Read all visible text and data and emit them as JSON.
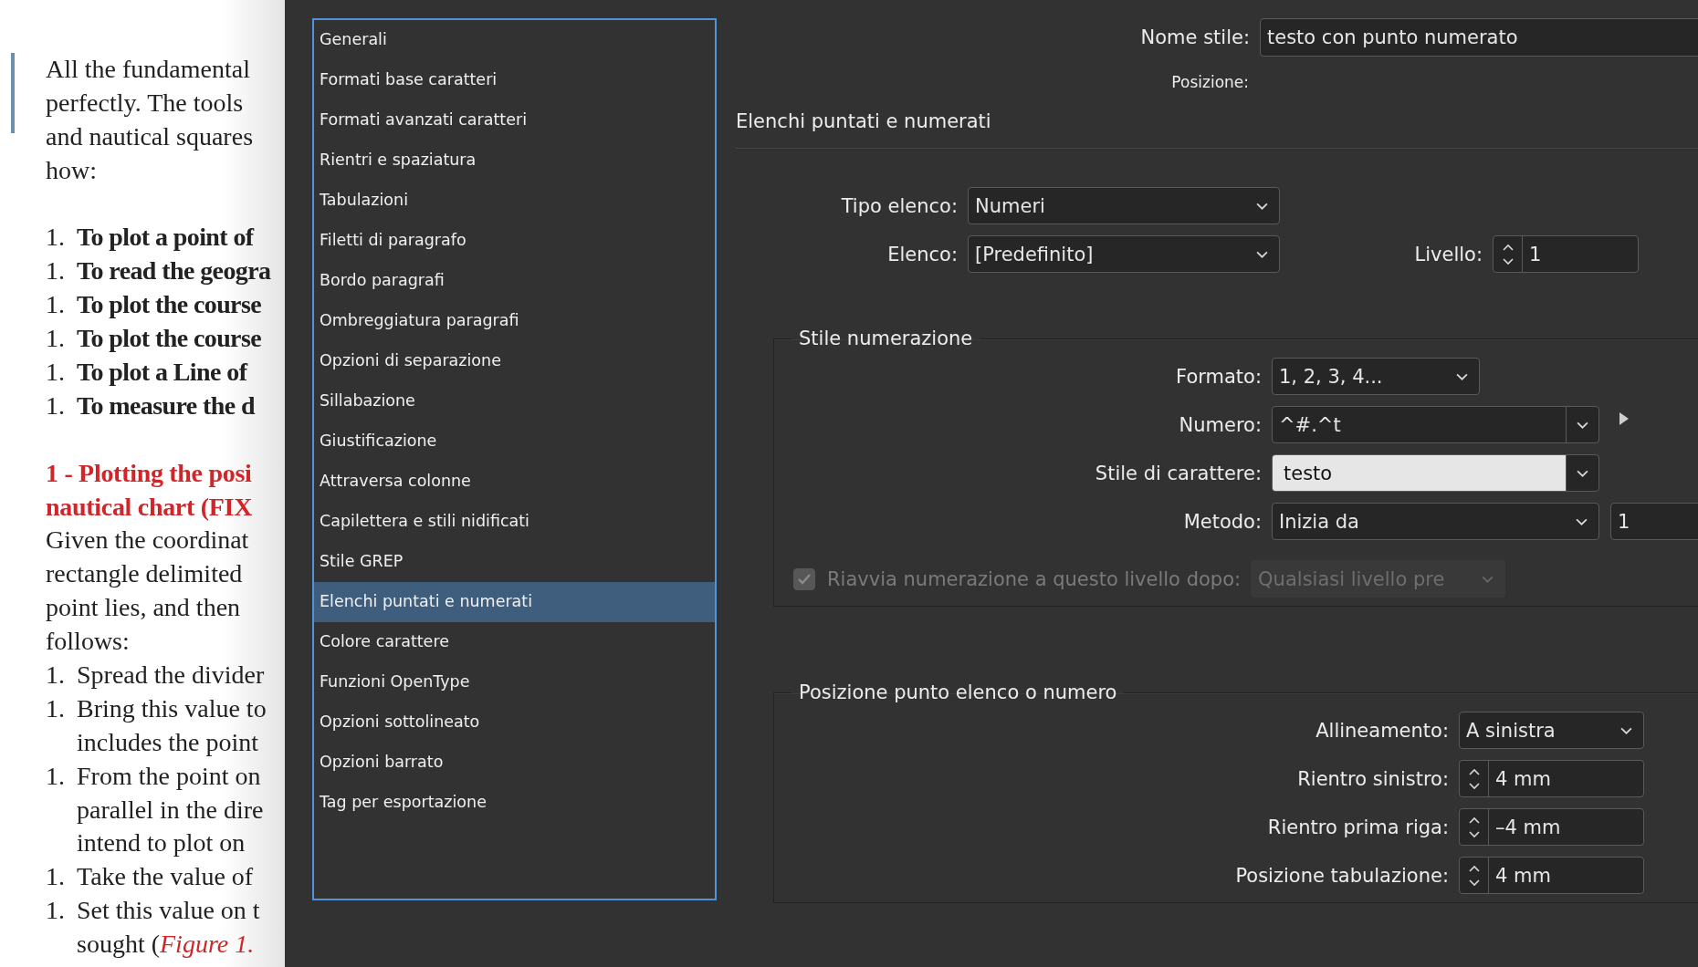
{
  "document": {
    "blocks": [
      {
        "kind": "para",
        "lines": [
          "All the fundamental",
          "perfectly. The tools",
          "and nautical squares",
          "how:"
        ]
      },
      {
        "kind": "gap"
      },
      {
        "kind": "list",
        "bold": true,
        "items": [
          {
            "number": "1.",
            "lines": [
              "To plot a point of"
            ]
          },
          {
            "number": "1.",
            "lines": [
              "To read the geogra"
            ]
          },
          {
            "number": "1.",
            "lines": [
              "To plot the course"
            ]
          },
          {
            "number": "1.",
            "lines": [
              "To plot the course"
            ]
          },
          {
            "number": "1.",
            "lines": [
              "To plot a Line of"
            ]
          },
          {
            "number": "1.",
            "lines": [
              "To measure the d"
            ]
          }
        ]
      },
      {
        "kind": "gap"
      },
      {
        "kind": "heading",
        "lines": [
          "1 - Plotting the posi",
          "nautical chart (FIX"
        ]
      },
      {
        "kind": "para",
        "lines": [
          "Given the coordinat",
          "rectangle delimited",
          "point lies, and then",
          "follows:"
        ]
      },
      {
        "kind": "list",
        "bold": false,
        "items": [
          {
            "number": "1.",
            "lines": [
              "Spread the divider"
            ]
          },
          {
            "number": "1.",
            "lines": [
              "Bring this value to",
              "includes the point"
            ]
          },
          {
            "number": "1.",
            "lines": [
              "From the point on",
              "parallel in the dire",
              "intend to plot on"
            ]
          },
          {
            "number": "1.",
            "lines": [
              "Take the value of"
            ]
          },
          {
            "number": "1.",
            "lines": [
              "Set this value on t",
              "sought (*Figure 1.*"
            ]
          }
        ]
      }
    ]
  },
  "sidebar": {
    "items": [
      {
        "label": "Generali",
        "selected": false
      },
      {
        "label": "Formati base caratteri",
        "selected": false
      },
      {
        "label": "Formati avanzati caratteri",
        "selected": false
      },
      {
        "label": "Rientri e spaziatura",
        "selected": false
      },
      {
        "label": "Tabulazioni",
        "selected": false
      },
      {
        "label": "Filetti di paragrafo",
        "selected": false
      },
      {
        "label": "Bordo paragrafi",
        "selected": false
      },
      {
        "label": "Ombreggiatura paragrafi",
        "selected": false
      },
      {
        "label": "Opzioni di separazione",
        "selected": false
      },
      {
        "label": "Sillabazione",
        "selected": false
      },
      {
        "label": "Giustificazione",
        "selected": false
      },
      {
        "label": "Attraversa colonne",
        "selected": false
      },
      {
        "label": "Capilettera e stili nidificati",
        "selected": false
      },
      {
        "label": "Stile GREP",
        "selected": false
      },
      {
        "label": "Elenchi puntati e numerati",
        "selected": true
      },
      {
        "label": "Colore carattere",
        "selected": false
      },
      {
        "label": "Funzioni OpenType",
        "selected": false
      },
      {
        "label": "Opzioni sottolineato",
        "selected": false
      },
      {
        "label": "Opzioni barrato",
        "selected": false
      },
      {
        "label": "Tag per esportazione",
        "selected": false
      }
    ]
  },
  "panel": {
    "style_name": {
      "label": "Nome stile:",
      "value": "testo con punto numerato"
    },
    "position_label": "Posizione:",
    "section_title": "Elenchi puntati e numerati",
    "list_type": {
      "label": "Tipo elenco:",
      "value": "Numeri"
    },
    "list": {
      "label": "Elenco:",
      "value": "[Predefinito]"
    },
    "level": {
      "label": "Livello:",
      "value": "1"
    },
    "numbering_style": {
      "title": "Stile numerazione",
      "fields": [
        {
          "kind": "dropdown",
          "label": "Formato:",
          "value": "1, 2, 3, 4..."
        },
        {
          "kind": "combo",
          "label": "Numero:",
          "value": "^#.^t",
          "flyout": true
        },
        {
          "kind": "stylecombo",
          "label": "Stile di carattere:",
          "value": "testo"
        },
        {
          "kind": "startselect",
          "label": "Metodo:",
          "value": "Inizia da",
          "start": "1"
        }
      ],
      "restart": {
        "label": "Riavvia numerazione a questo livello dopo:",
        "checked": true,
        "disabled": true,
        "value": "Qualsiasi livello pre"
      }
    },
    "position": {
      "title": "Posizione punto elenco o numero",
      "fields": [
        {
          "kind": "select",
          "label": "Allineamento:",
          "value": "A sinistra"
        },
        {
          "kind": "spinner",
          "label": "Rientro sinistro:",
          "value": "4 mm"
        },
        {
          "kind": "spinner",
          "label": "Rientro prima riga:",
          "value": "–4 mm"
        },
        {
          "kind": "spinner",
          "label": "Posizione tabulazione:",
          "value": "4 mm"
        }
      ]
    }
  }
}
